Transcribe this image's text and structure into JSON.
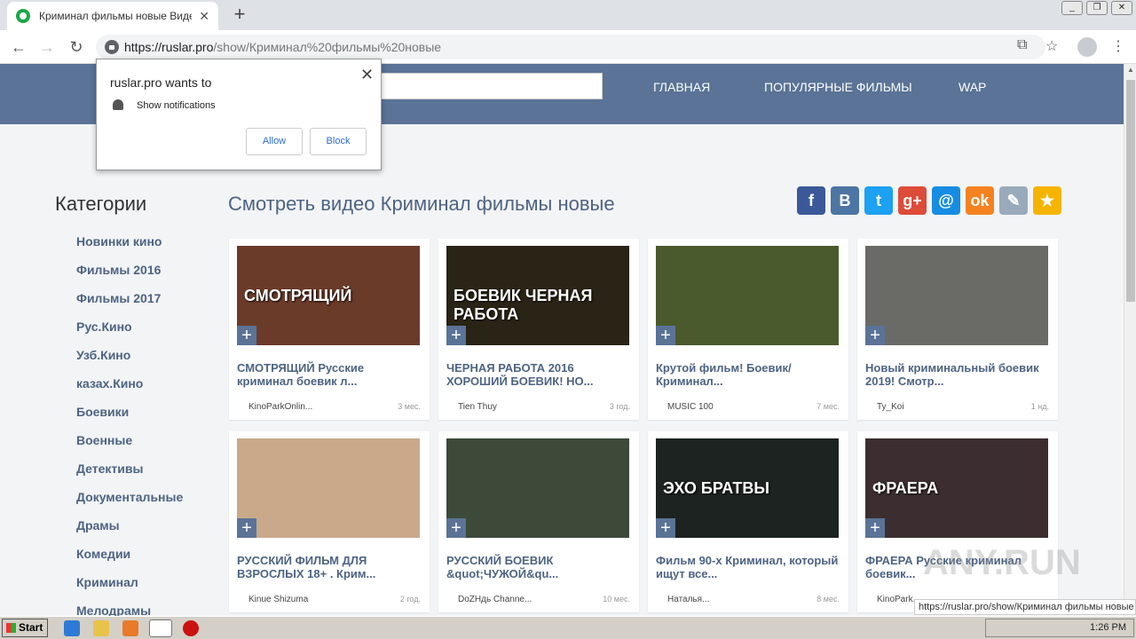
{
  "browser": {
    "tab_title": "Криминал фильмы новые Видео - F",
    "tab_close": "✕",
    "new_tab": "+",
    "url_host": "https://ruslar.pro",
    "url_path": "/show/Криминал%20фильмы%20новые"
  },
  "site": {
    "nav": [
      "ГЛАВНАЯ",
      "ПОПУЛЯРНЫЕ ФИЛЬМЫ",
      "WAP"
    ],
    "sidebar_title": "Категории",
    "categories": [
      "Новинки кино",
      "Фильмы 2016",
      "Фильмы 2017",
      "Рус.Кино",
      "Узб.Кино",
      "казах.Кино",
      "Боевики",
      "Военные",
      "Детективы",
      "Документальные",
      "Драмы",
      "Комедии",
      "Криминал",
      "Мелодрамы"
    ],
    "main_title": "Смотреть видео Криминал фильмы новые",
    "share": [
      {
        "icon": "facebook-icon",
        "glyph": "f",
        "color": "#3b5998"
      },
      {
        "icon": "vk-icon",
        "glyph": "B",
        "color": "#4c75a3"
      },
      {
        "icon": "twitter-icon",
        "glyph": "t",
        "color": "#1da1f2"
      },
      {
        "icon": "google-plus-icon",
        "glyph": "g+",
        "color": "#dd4b39"
      },
      {
        "icon": "mail-icon",
        "glyph": "@",
        "color": "#168de2"
      },
      {
        "icon": "odnoklassniki-icon",
        "glyph": "ok",
        "color": "#f58220"
      },
      {
        "icon": "livejournal-icon",
        "glyph": "✎",
        "color": "#9ab"
      },
      {
        "icon": "favorite-star-icon",
        "glyph": "★",
        "color": "#f5b400"
      }
    ]
  },
  "videos": [
    {
      "title": "СМОТРЯЩИЙ Русские криминал боевик л...",
      "channel": "KinoParkOnlin...",
      "age": "3 мес.",
      "thumb_text": "СМОТРЯЩИЙ",
      "thumb_bg": "#6b3b2a"
    },
    {
      "title": "ЧЕРНАЯ РАБОТА 2016 ХОРОШИЙ БОЕВИК! НО...",
      "channel": "Tien Thuy",
      "age": "3 год.",
      "thumb_text": "БОЕВИК ЧЕРНАЯ РАБОТА",
      "thumb_bg": "#2a2416"
    },
    {
      "title": "Крутой фильм! Боевик/ Криминал...",
      "channel": "MUSIC 100",
      "age": "7 мес.",
      "thumb_text": "",
      "thumb_bg": "#4b5a2c"
    },
    {
      "title": "Новый криминальный боевик 2019! Смотр...",
      "channel": "Ty_Koi",
      "age": "1 нд.",
      "thumb_text": "",
      "thumb_bg": "#6a6a66"
    },
    {
      "title": "РУССКИЙ ФИЛЬМ ДЛЯ ВЗРОСЛЫХ 18+ . Крим...",
      "channel": "Kinue Shizuma",
      "age": "2 год.",
      "thumb_text": "",
      "thumb_bg": "#c9a98a"
    },
    {
      "title": "РУССКИЙ БОЕВИК &quot;ЧУЖОЙ&qu...",
      "channel": "DoZHдь Channe...",
      "age": "10 мес.",
      "thumb_text": "",
      "thumb_bg": "#3d4a3a"
    },
    {
      "title": "Фильм 90-х Криминал, который ищут все...",
      "channel": "Наталья...",
      "age": "8 мес.",
      "thumb_text": "ЭХО БРАТВЫ",
      "thumb_bg": "#1d2320"
    },
    {
      "title": "ФРАЕРА Русские криминал боевик...",
      "channel": "KinoPark...",
      "age": "",
      "thumb_text": "ФРАЕРА",
      "thumb_bg": "#3c2e30"
    }
  ],
  "popup": {
    "title": "ruslar.pro wants to",
    "notification": "Show notifications",
    "allow": "Allow",
    "block": "Block",
    "close": "✕"
  },
  "status_url": "https://ruslar.pro/show/Криминал фильмы новые",
  "taskbar": {
    "start": "Start",
    "clock": "1:26 PM"
  },
  "watermark": "ANY.RUN"
}
